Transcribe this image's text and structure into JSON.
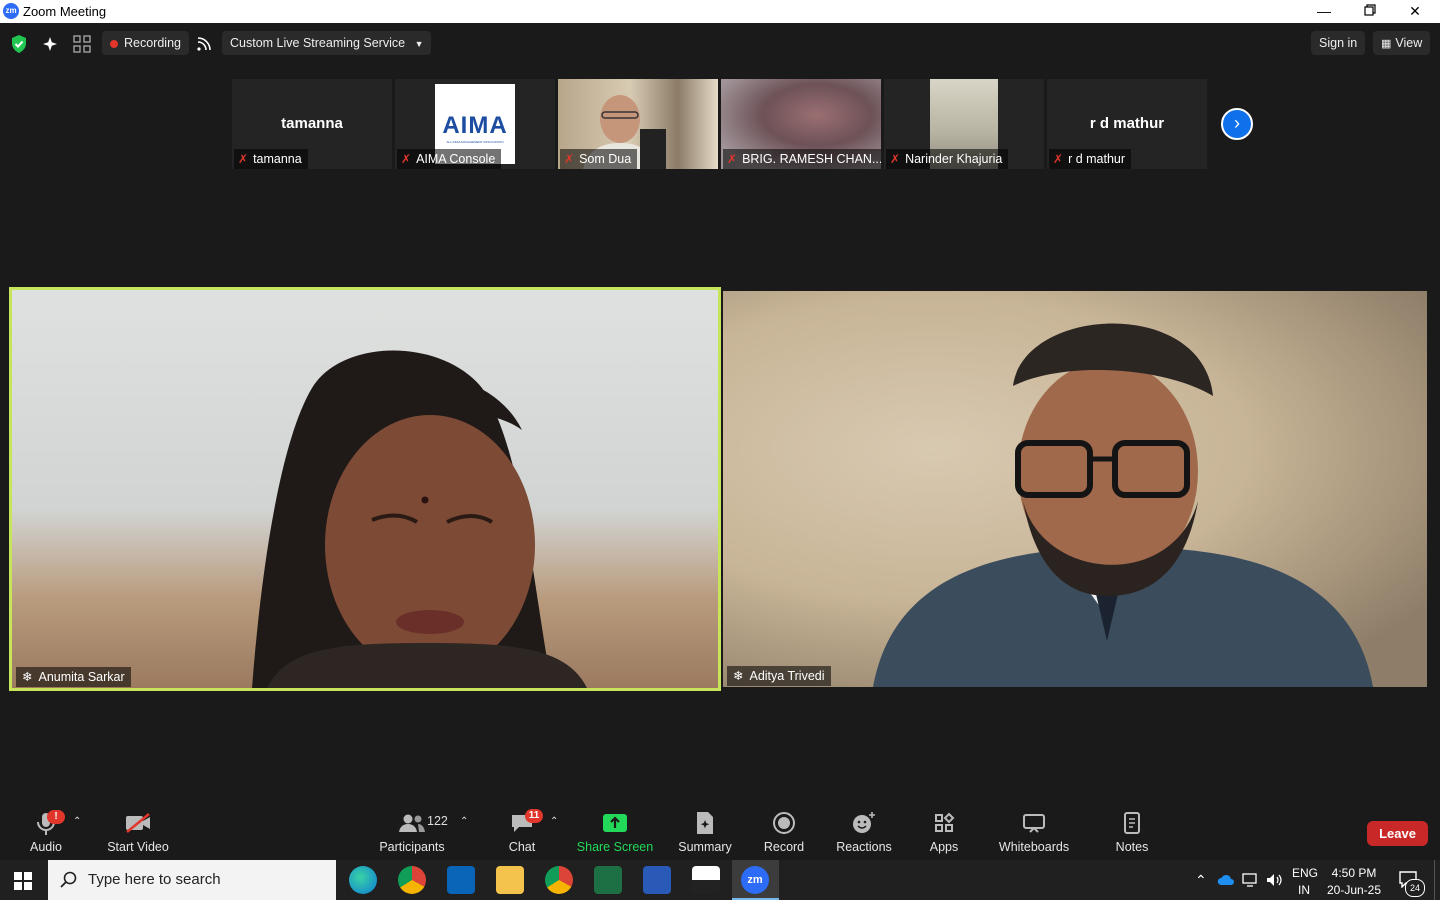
{
  "window": {
    "title": "Zoom Meeting",
    "app_icon_text": "zm",
    "controls": [
      "minimize-icon",
      "restore-icon",
      "close-icon"
    ]
  },
  "topbar": {
    "recording_label": "Recording",
    "stream_service": "Custom Live Streaming Service",
    "sign_in": "Sign in",
    "view": "View"
  },
  "filmstrip": [
    {
      "name": "tamanna",
      "display": "tamanna",
      "muted": true
    },
    {
      "name": "AIMA Console",
      "logo_text": "AIMA",
      "logo_sub": "ALL INDIA MANAGEMENT ASSOCIATION",
      "muted": true
    },
    {
      "name": "Som Dua",
      "muted": true
    },
    {
      "name": "BRIG. RAMESH CHAN...",
      "muted": true
    },
    {
      "name": "Narinder Khajuria",
      "muted": true
    },
    {
      "name": "r d mathur",
      "display": "r d mathur",
      "muted": true
    }
  ],
  "main_videos": [
    {
      "name": "Anumita Sarkar",
      "active_speaker": true
    },
    {
      "name": "Aditya Trivedi",
      "active_speaker": false
    }
  ],
  "toolbar": {
    "audio": "Audio",
    "audio_alert": "!",
    "start_video": "Start Video",
    "participants": "Participants",
    "participants_count": "122",
    "chat": "Chat",
    "chat_badge": "11",
    "share_screen": "Share Screen",
    "summary": "Summary",
    "record": "Record",
    "reactions": "Reactions",
    "apps": "Apps",
    "whiteboards": "Whiteboards",
    "notes": "Notes",
    "leave": "Leave"
  },
  "taskbar": {
    "search_placeholder": "Type here to search",
    "lang_top": "ENG",
    "lang_bottom": "IN",
    "time": "4:50 PM",
    "date": "20-Jun-25",
    "notification_count": "24",
    "apps": [
      "edge-icon",
      "chrome-profile-a-icon",
      "outlook-icon",
      "file-explorer-icon",
      "chrome-profile-c-icon",
      "excel-icon",
      "word-icon",
      "photos-icon",
      "zoom-icon"
    ]
  },
  "colors": {
    "active_speaker_border": "#c7e55a",
    "leave_button": "#c82828",
    "share_screen": "#23d959",
    "accent_blue": "#0e71eb"
  }
}
